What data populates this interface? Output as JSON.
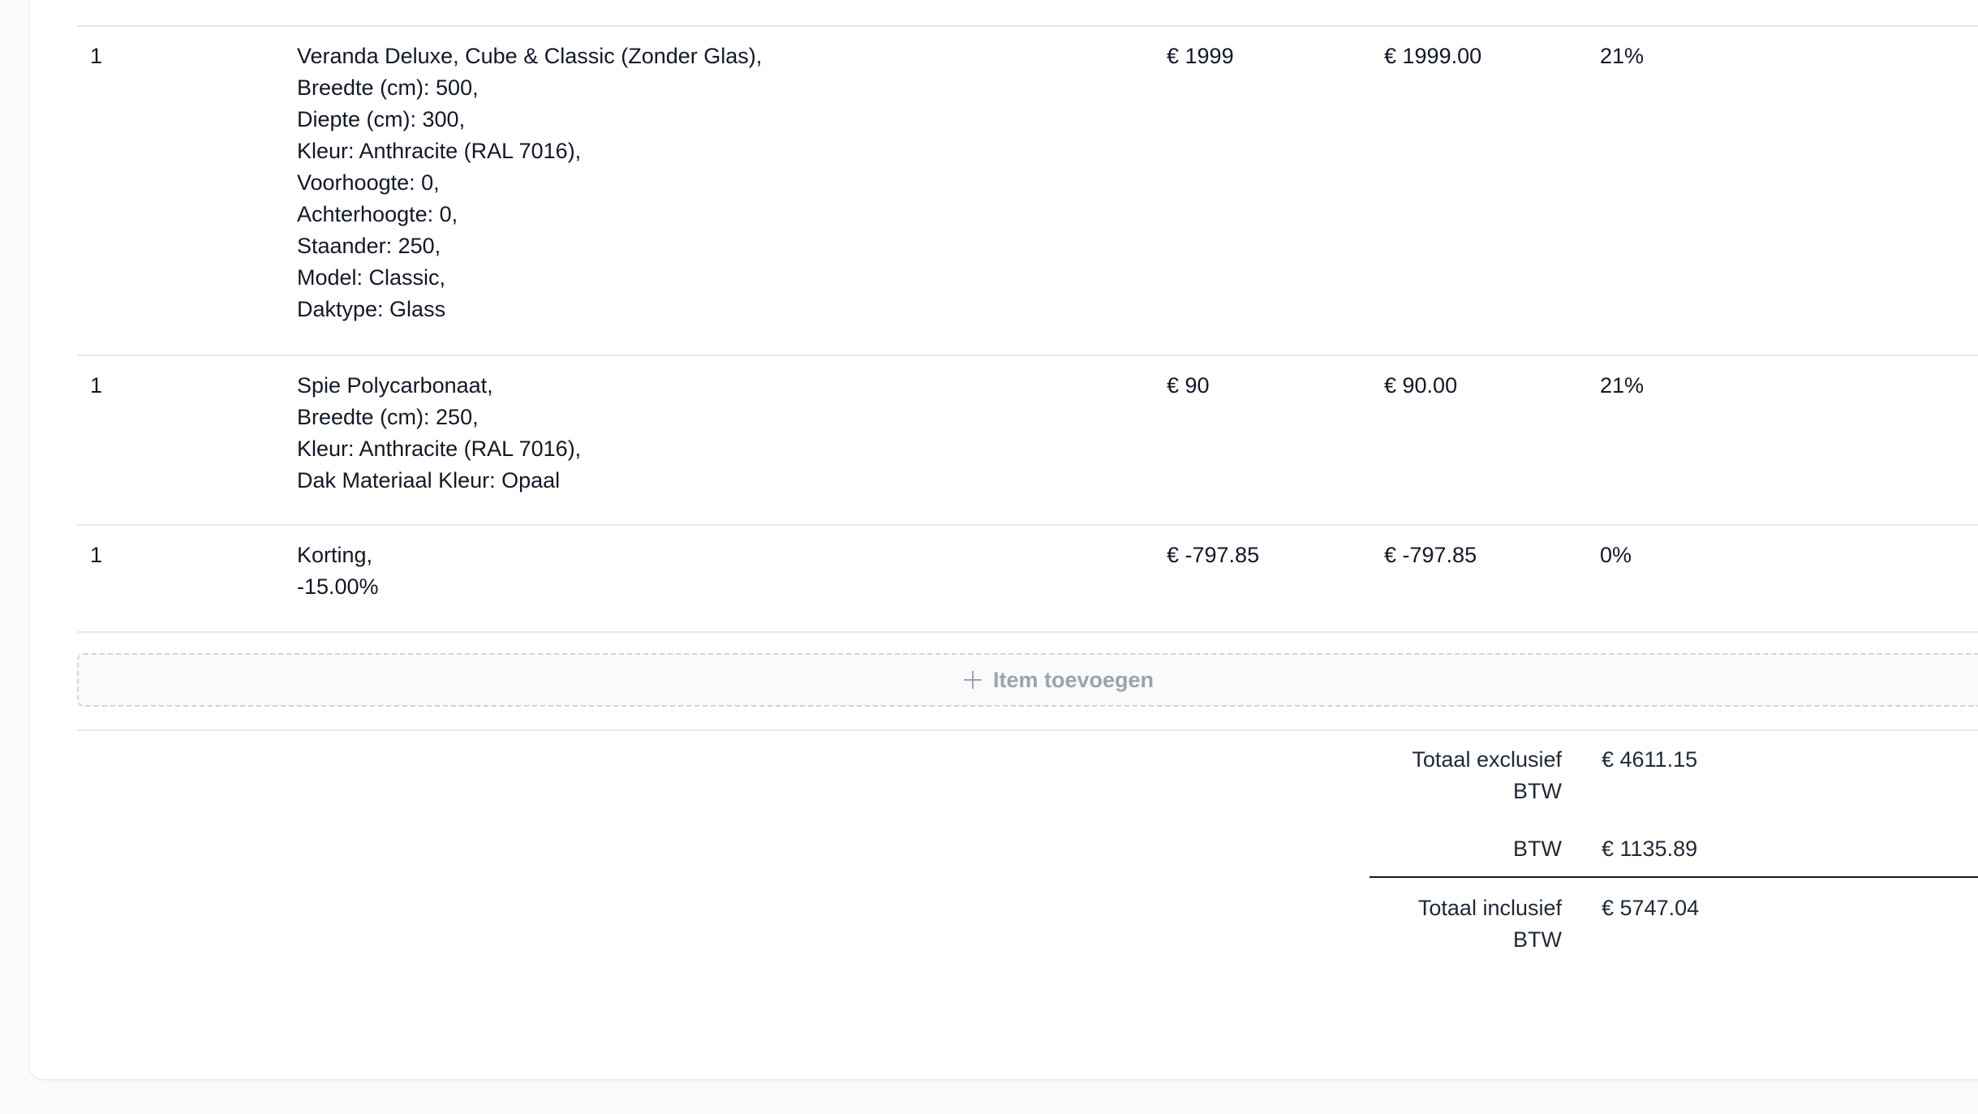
{
  "line_items": [
    {
      "qty": "1",
      "description": [
        "Veranda Deluxe, Cube & Classic (Zonder Glas),",
        "Breedte (cm): 500,",
        "Diepte (cm): 300,",
        "Kleur: Anthracite (RAL 7016),",
        "Voorhoogte: 0,",
        "Achterhoogte: 0,",
        "Staander: 250,",
        "Model: Classic,",
        "Daktype: Glass"
      ],
      "unit_price": "€ 1999",
      "total": "€ 1999.00",
      "vat": "21%"
    },
    {
      "qty": "1",
      "description": [
        "Spie Polycarbonaat,",
        "Breedte (cm): 250,",
        "Kleur: Anthracite (RAL 7016),",
        "Dak Materiaal Kleur: Opaal"
      ],
      "unit_price": "€ 90",
      "total": "€ 90.00",
      "vat": "21%"
    },
    {
      "qty": "1",
      "description": [
        "Korting,",
        "-15.00%"
      ],
      "unit_price": "€ -797.85",
      "total": "€ -797.85",
      "vat": "0%"
    }
  ],
  "add_item": {
    "label": "Item toevoegen",
    "icon": "plus-icon"
  },
  "totals": {
    "excl_label_1": "Totaal exclusief",
    "excl_label_2": "BTW",
    "excl_value": "€ 4611.15",
    "vat_label": "BTW",
    "vat_value": "€ 1135.89",
    "incl_label_1": "Totaal inclusief",
    "incl_label_2": "BTW",
    "incl_value": "€ 5747.04"
  },
  "colors": {
    "text": "#111827",
    "muted": "#9ca3af",
    "border": "#e5e7eb",
    "background": "#f9fafb"
  }
}
